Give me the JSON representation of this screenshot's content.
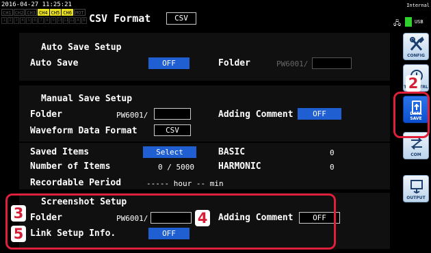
{
  "topbar": {
    "datetime": "2016-04-27 11:25:21",
    "channels": [
      {
        "label": "CH1",
        "active": false
      },
      {
        "label": "CH2",
        "active": false
      },
      {
        "label": "CH3",
        "active": false
      },
      {
        "label": "CH4",
        "active": true
      },
      {
        "label": "CH5",
        "active": true
      },
      {
        "label": "CH6",
        "active": true
      },
      {
        "label": "MOT",
        "active": false
      }
    ],
    "wires": [
      "1",
      "2",
      "3",
      "4",
      "5",
      "6",
      "7",
      "8",
      "9",
      "10",
      "11",
      "12",
      "A",
      "B"
    ],
    "title": "CSV Format",
    "format_value": "CSV",
    "storage_label": "Internal",
    "usb_label": "USB"
  },
  "menu": {
    "items": [
      {
        "label": "CONFIG",
        "icon": "wrench-screwdriver-icon"
      },
      {
        "label": "TIME CTRL",
        "icon": "clock-icon"
      },
      {
        "label": "DATA SAVE",
        "icon": "usb-drive-icon"
      },
      {
        "label": "COM",
        "icon": "exchange-arrows-icon"
      },
      {
        "label": "OUTPUT",
        "icon": "output-icon"
      }
    ]
  },
  "auto_save": {
    "heading": "Auto Save Setup",
    "auto_save_label": "Auto Save",
    "auto_save_value": "OFF",
    "folder_label": "Folder",
    "folder_value": "PW6001/"
  },
  "manual_save": {
    "heading": "Manual Save Setup",
    "folder_label": "Folder",
    "folder_value": "PW6001/",
    "comment_label": "Adding Comment",
    "comment_value": "OFF",
    "waveform_label": "Waveform Data Format",
    "waveform_value": "CSV"
  },
  "saved_items": {
    "saved_items_label": "Saved Items",
    "select_label": "Select",
    "basic_label": "BASIC",
    "basic_value": "0",
    "number_label": "Number of Items",
    "number_value": "0 / 5000",
    "harmonic_label": "HARMONIC",
    "harmonic_value": "0",
    "period_label": "Recordable Period",
    "period_value": "----- hour -- min"
  },
  "screenshot": {
    "heading": "Screenshot Setup",
    "folder_label": "Folder",
    "folder_value": "PW6001/",
    "comment_label": "Adding Comment",
    "comment_value": "OFF",
    "link_label": "Link Setup Info.",
    "link_value": "OFF"
  },
  "callouts": [
    "2",
    "3",
    "4",
    "5"
  ],
  "colors": {
    "accent_red": "#e0203a",
    "button_blue": "#1f5fd1",
    "channel_active": "#e8e020"
  }
}
